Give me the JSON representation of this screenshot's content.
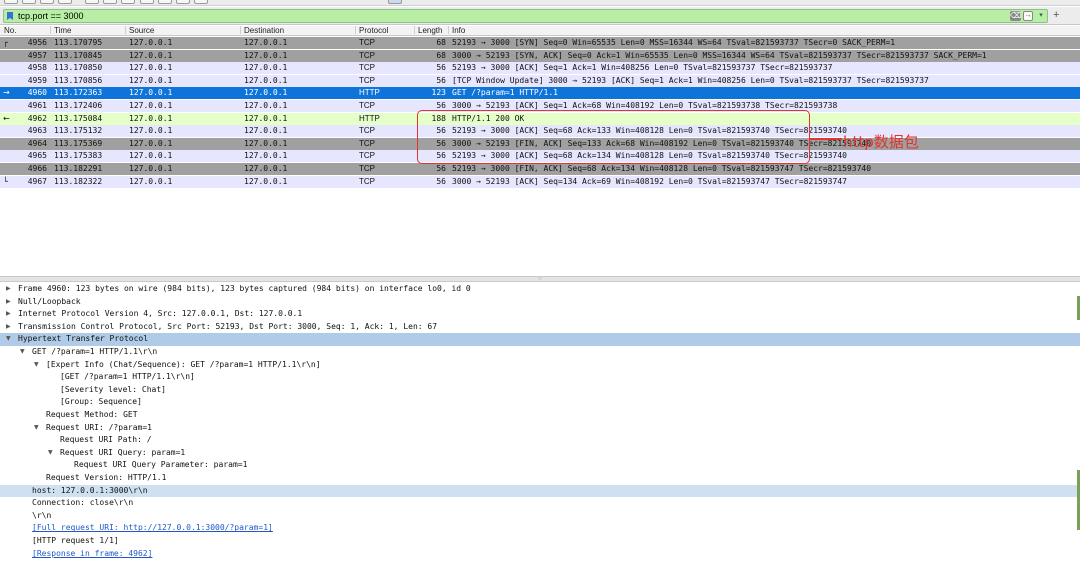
{
  "filter": {
    "value": "tcp.port == 3000",
    "clear_glyph": "⌫",
    "apply_glyph": "→",
    "dropdown_glyph": "▾",
    "add_glyph": "+"
  },
  "columns": {
    "no": "No.",
    "time": "Time",
    "source": "Source",
    "destination": "Destination",
    "protocol": "Protocol",
    "length": "Length",
    "info": "Info"
  },
  "packets": [
    {
      "no": "4956",
      "time": "113.170795",
      "src": "127.0.0.1",
      "dst": "127.0.0.1",
      "proto": "TCP",
      "len": "68",
      "info": "52193 → 3000 [SYN] Seq=0 Win=65535 Len=0 MSS=16344 WS=64 TSval=821593737 TSecr=0 SACK_PERM=1",
      "style": "gray",
      "mark": "┌"
    },
    {
      "no": "4957",
      "time": "113.170845",
      "src": "127.0.0.1",
      "dst": "127.0.0.1",
      "proto": "TCP",
      "len": "68",
      "info": "3000 → 52193 [SYN, ACK] Seq=0 Ack=1 Win=65535 Len=0 MSS=16344 WS=64 TSval=821593737 TSecr=821593737 SACK_PERM=1",
      "style": "gray",
      "mark": ""
    },
    {
      "no": "4958",
      "time": "113.170850",
      "src": "127.0.0.1",
      "dst": "127.0.0.1",
      "proto": "TCP",
      "len": "56",
      "info": "52193 → 3000 [ACK] Seq=1 Ack=1 Win=408256 Len=0 TSval=821593737 TSecr=821593737",
      "style": "lavender",
      "mark": ""
    },
    {
      "no": "4959",
      "time": "113.170856",
      "src": "127.0.0.1",
      "dst": "127.0.0.1",
      "proto": "TCP",
      "len": "56",
      "info": "[TCP Window Update] 3000 → 52193 [ACK] Seq=1 Ack=1 Win=408256 Len=0 TSval=821593737 TSecr=821593737",
      "style": "lavender",
      "mark": ""
    },
    {
      "no": "4960",
      "time": "113.172363",
      "src": "127.0.0.1",
      "dst": "127.0.0.1",
      "proto": "HTTP",
      "len": "123",
      "info": "GET /?param=1 HTTP/1.1",
      "style": "selected",
      "mark": "→"
    },
    {
      "no": "4961",
      "time": "113.172406",
      "src": "127.0.0.1",
      "dst": "127.0.0.1",
      "proto": "TCP",
      "len": "56",
      "info": "3000 → 52193 [ACK] Seq=1 Ack=68 Win=408192 Len=0 TSval=821593738 TSecr=821593738",
      "style": "lavender",
      "mark": ""
    },
    {
      "no": "4962",
      "time": "113.175084",
      "src": "127.0.0.1",
      "dst": "127.0.0.1",
      "proto": "HTTP",
      "len": "188",
      "info": "HTTP/1.1 200 OK",
      "style": "green",
      "mark": "←"
    },
    {
      "no": "4963",
      "time": "113.175132",
      "src": "127.0.0.1",
      "dst": "127.0.0.1",
      "proto": "TCP",
      "len": "56",
      "info": "52193 → 3000 [ACK] Seq=68 Ack=133 Win=408128 Len=0 TSval=821593740 TSecr=821593740",
      "style": "lavender",
      "mark": ""
    },
    {
      "no": "4964",
      "time": "113.175369",
      "src": "127.0.0.1",
      "dst": "127.0.0.1",
      "proto": "TCP",
      "len": "56",
      "info": "3000 → 52193 [FIN, ACK] Seq=133 Ack=68 Win=408192 Len=0 TSval=821593740 TSecr=821593740",
      "style": "gray",
      "mark": ""
    },
    {
      "no": "4965",
      "time": "113.175383",
      "src": "127.0.0.1",
      "dst": "127.0.0.1",
      "proto": "TCP",
      "len": "56",
      "info": "52193 → 3000 [ACK] Seq=68 Ack=134 Win=408128 Len=0 TSval=821593740 TSecr=821593740",
      "style": "lavender",
      "mark": ""
    },
    {
      "no": "4966",
      "time": "113.182291",
      "src": "127.0.0.1",
      "dst": "127.0.0.1",
      "proto": "TCP",
      "len": "56",
      "info": "52193 → 3000 [FIN, ACK] Seq=68 Ack=134 Win=408128 Len=0 TSval=821593747 TSecr=821593740",
      "style": "gray",
      "mark": ""
    },
    {
      "no": "4967",
      "time": "113.182322",
      "src": "127.0.0.1",
      "dst": "127.0.0.1",
      "proto": "TCP",
      "len": "56",
      "info": "3000 → 52193 [ACK] Seq=134 Ack=69 Win=408192 Len=0 TSval=821593747 TSecr=821593747",
      "style": "lavender",
      "mark": "└"
    }
  ],
  "annotation": {
    "label": "http数据包",
    "color": "#e0342f"
  },
  "details": [
    {
      "indent": 0,
      "arrow": "▶",
      "text": "Frame 4960: 123 bytes on wire (984 bits), 123 bytes captured (984 bits) on interface lo0, id 0",
      "style": ""
    },
    {
      "indent": 0,
      "arrow": "▶",
      "text": "Null/Loopback",
      "style": ""
    },
    {
      "indent": 0,
      "arrow": "▶",
      "text": "Internet Protocol Version 4, Src: 127.0.0.1, Dst: 127.0.0.1",
      "style": ""
    },
    {
      "indent": 0,
      "arrow": "▶",
      "text": "Transmission Control Protocol, Src Port: 52193, Dst Port: 3000, Seq: 1, Ack: 1, Len: 67",
      "style": ""
    },
    {
      "indent": 0,
      "arrow": "▼",
      "text": "Hypertext Transfer Protocol",
      "style": "sel"
    },
    {
      "indent": 1,
      "arrow": "▼",
      "text": "GET /?param=1 HTTP/1.1\\r\\n",
      "style": ""
    },
    {
      "indent": 2,
      "arrow": "▼",
      "text": "[Expert Info (Chat/Sequence): GET /?param=1 HTTP/1.1\\r\\n]",
      "style": ""
    },
    {
      "indent": 3,
      "arrow": "",
      "text": "[GET /?param=1 HTTP/1.1\\r\\n]",
      "style": ""
    },
    {
      "indent": 3,
      "arrow": "",
      "text": "[Severity level: Chat]",
      "style": ""
    },
    {
      "indent": 3,
      "arrow": "",
      "text": "[Group: Sequence]",
      "style": ""
    },
    {
      "indent": 2,
      "arrow": "",
      "text": "Request Method: GET",
      "style": ""
    },
    {
      "indent": 2,
      "arrow": "▼",
      "text": "Request URI: /?param=1",
      "style": ""
    },
    {
      "indent": 3,
      "arrow": "",
      "text": "Request URI Path: /",
      "style": ""
    },
    {
      "indent": 3,
      "arrow": "▼",
      "text": "Request URI Query: param=1",
      "style": ""
    },
    {
      "indent": 4,
      "arrow": "",
      "text": "Request URI Query Parameter: param=1",
      "style": ""
    },
    {
      "indent": 2,
      "arrow": "",
      "text": "Request Version: HTTP/1.1",
      "style": ""
    },
    {
      "indent": 1,
      "arrow": "",
      "text": "host: 127.0.0.1:3000\\r\\n",
      "style": "hl"
    },
    {
      "indent": 1,
      "arrow": "",
      "text": "Connection: close\\r\\n",
      "style": ""
    },
    {
      "indent": 1,
      "arrow": "",
      "text": "\\r\\n",
      "style": ""
    },
    {
      "indent": 1,
      "arrow": "",
      "text": "[Full request URI: http://127.0.0.1:3000/?param=1]",
      "style": "link"
    },
    {
      "indent": 1,
      "arrow": "",
      "text": "[HTTP request 1/1]",
      "style": ""
    },
    {
      "indent": 1,
      "arrow": "",
      "text": "[Response in frame: 4962]",
      "style": "link"
    }
  ],
  "colors": {
    "gray": "#a0a0a0",
    "lavender": "#e7e6ff",
    "green": "#e4ffc7",
    "selected": "#0f74da",
    "filter_valid": "#b7f0a4"
  }
}
